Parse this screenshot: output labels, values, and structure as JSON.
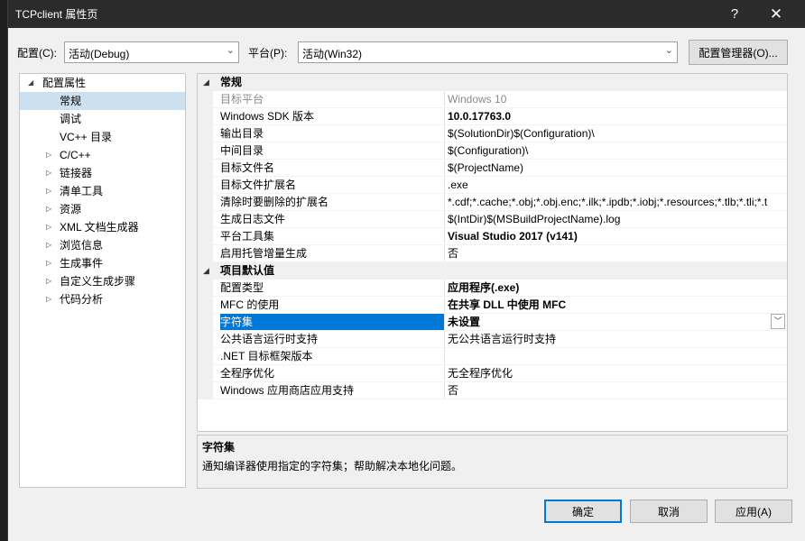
{
  "window": {
    "title": "TCPclient 属性页",
    "help": "?",
    "close": "✕"
  },
  "toolbar": {
    "config_label": "配置(C):",
    "config_value": "活动(Debug)",
    "platform_label": "平台(P):",
    "platform_value": "活动(Win32)",
    "config_manager": "配置管理器(O)..."
  },
  "tree": [
    {
      "label": "配置属性",
      "expander": "◢",
      "indent": 0
    },
    {
      "label": "常规",
      "expander": "",
      "indent": 2,
      "selected": true
    },
    {
      "label": "调试",
      "expander": "",
      "indent": 2
    },
    {
      "label": "VC++ 目录",
      "expander": "",
      "indent": 2
    },
    {
      "label": "C/C++",
      "expander": "▷",
      "indent": 2
    },
    {
      "label": "链接器",
      "expander": "▷",
      "indent": 2
    },
    {
      "label": "清单工具",
      "expander": "▷",
      "indent": 2
    },
    {
      "label": "资源",
      "expander": "▷",
      "indent": 2
    },
    {
      "label": "XML 文档生成器",
      "expander": "▷",
      "indent": 2
    },
    {
      "label": "浏览信息",
      "expander": "▷",
      "indent": 2
    },
    {
      "label": "生成事件",
      "expander": "▷",
      "indent": 2
    },
    {
      "label": "自定义生成步骤",
      "expander": "▷",
      "indent": 2
    },
    {
      "label": "代码分析",
      "expander": "▷",
      "indent": 2
    }
  ],
  "grid": {
    "sections": [
      {
        "title": "常规",
        "rows": [
          {
            "name": "目标平台",
            "value": "Windows 10",
            "style": "dim"
          },
          {
            "name": "Windows SDK 版本",
            "value": "10.0.17763.0",
            "style": "bold"
          },
          {
            "name": "输出目录",
            "value": "$(SolutionDir)$(Configuration)\\"
          },
          {
            "name": "中间目录",
            "value": "$(Configuration)\\"
          },
          {
            "name": "目标文件名",
            "value": "$(ProjectName)"
          },
          {
            "name": "目标文件扩展名",
            "value": ".exe"
          },
          {
            "name": "清除时要删除的扩展名",
            "value": "*.cdf;*.cache;*.obj;*.obj.enc;*.ilk;*.ipdb;*.iobj;*.resources;*.tlb;*.tli;*.t"
          },
          {
            "name": "生成日志文件",
            "value": "$(IntDir)$(MSBuildProjectName).log"
          },
          {
            "name": "平台工具集",
            "value": "Visual Studio 2017 (v141)",
            "style": "bold"
          },
          {
            "name": "启用托管增量生成",
            "value": "否"
          }
        ]
      },
      {
        "title": "项目默认值",
        "rows": [
          {
            "name": "配置类型",
            "value": "应用程序(.exe)",
            "style": "bold"
          },
          {
            "name": "MFC 的使用",
            "value": "在共享 DLL 中使用 MFC",
            "style": "bold"
          },
          {
            "name": "字符集",
            "value": "未设置",
            "style": "bold",
            "selected": true
          },
          {
            "name": "公共语言运行时支持",
            "value": "无公共语言运行时支持"
          },
          {
            "name": ".NET 目标框架版本",
            "value": ""
          },
          {
            "name": "全程序优化",
            "value": "无全程序优化"
          },
          {
            "name": "Windows 应用商店应用支持",
            "value": "否"
          }
        ]
      }
    ]
  },
  "description": {
    "title": "字符集",
    "text": "通知编译器使用指定的字符集；帮助解决本地化问题。"
  },
  "buttons": {
    "ok": "确定",
    "cancel": "取消",
    "apply": "应用(A)"
  },
  "icons": {
    "collapse": "◢",
    "expand": "▷",
    "dropdown": "﹀",
    "combo_arrow": "⌵"
  }
}
